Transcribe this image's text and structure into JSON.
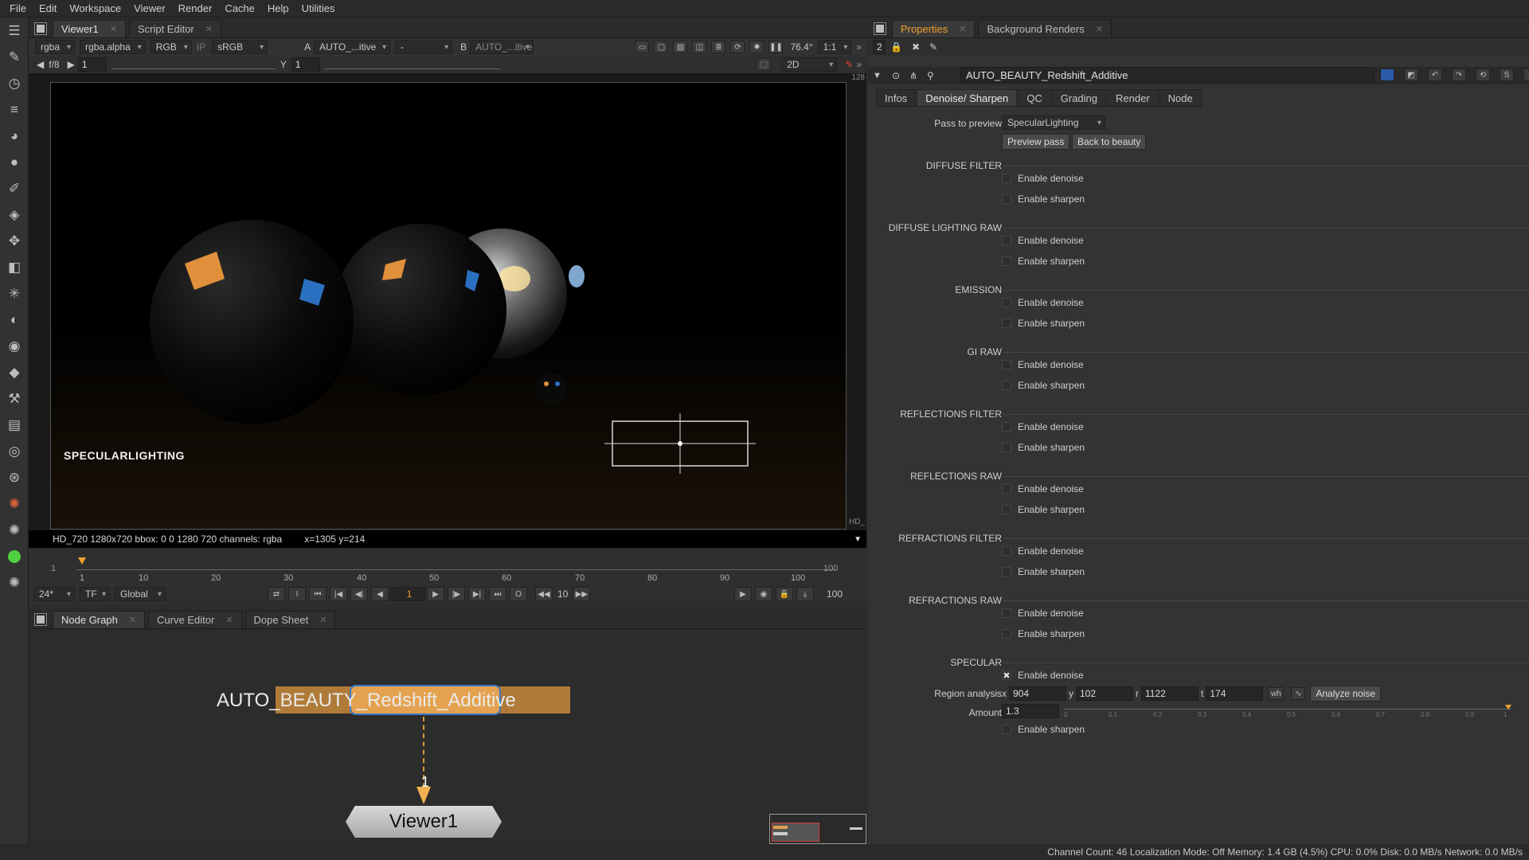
{
  "menu": [
    "File",
    "Edit",
    "Workspace",
    "Viewer",
    "Render",
    "Cache",
    "Help",
    "Utilities"
  ],
  "viewer_tabs": [
    {
      "label": "Viewer1"
    },
    {
      "label": "Script Editor"
    }
  ],
  "viewer_toolbar": {
    "channels": "rgba",
    "alpha": "rgba.alpha",
    "display": "RGB",
    "ip": "IP",
    "lut": "sRGB",
    "a_label": "A",
    "a_input": "AUTO_...itive",
    "a_op": "-",
    "b_label": "B",
    "b_input": "AUTO_...itive",
    "zoom": "76.4°",
    "ratio": "1:1",
    "mode": "2D"
  },
  "viewer_toolbar2": {
    "fstop": "f/8",
    "gain": "1",
    "gamma_label": "Y",
    "gamma": "1"
  },
  "viewer": {
    "frame_label": "SPECULARLIGHTING",
    "corner_top": "128",
    "corner_bottom": "HD_"
  },
  "info_bar": {
    "format": "HD_720 1280x720  bbox: 0 0 1280 720 channels: rgba",
    "coords": "x=1305 y=214"
  },
  "timeline": {
    "start": "1",
    "end": "100",
    "ticks": [
      "1",
      "10",
      "20",
      "30",
      "40",
      "50",
      "60",
      "70",
      "80",
      "90",
      "100"
    ]
  },
  "playback": {
    "fps": "24*",
    "tf": "TF",
    "range": "Global",
    "current": "1",
    "step": "10",
    "end": "100"
  },
  "lower_tabs": [
    {
      "label": "Node Graph"
    },
    {
      "label": "Curve Editor"
    },
    {
      "label": "Dope Sheet"
    }
  ],
  "node_graph": {
    "node": "AUTO_BEAUTY_Redshift_Additive",
    "viewer_node": "Viewer1",
    "pipe_num": "1"
  },
  "props_tabs": [
    {
      "label": "Properties"
    },
    {
      "label": "Background Renders"
    }
  ],
  "props": {
    "count": "2",
    "node_name": "AUTO_BEAUTY_Redshift_Additive",
    "tabs": [
      "Infos",
      "Denoise/ Sharpen",
      "QC",
      "Grading",
      "Render",
      "Node"
    ],
    "pass_label": "Pass to preview",
    "pass_value": "SpecularLighting",
    "preview_btn": "Preview pass",
    "back_btn": "Back to beauty",
    "sections": [
      {
        "title": "DIFFUSE FILTER",
        "denoise": "Enable denoise",
        "sharpen": "Enable sharpen"
      },
      {
        "title": "DIFFUSE LIGHTING RAW",
        "denoise": "Enable denoise",
        "sharpen": "Enable sharpen"
      },
      {
        "title": "EMISSION",
        "denoise": "Enable denoise",
        "sharpen": "Enable sharpen"
      },
      {
        "title": "GI RAW",
        "denoise": "Enable denoise",
        "sharpen": "Enable sharpen"
      },
      {
        "title": "REFLECTIONS FILTER",
        "denoise": "Enable denoise",
        "sharpen": "Enable sharpen"
      },
      {
        "title": "REFLECTIONS RAW",
        "denoise": "Enable denoise",
        "sharpen": "Enable sharpen"
      },
      {
        "title": "REFRACTIONS FILTER",
        "denoise": "Enable denoise",
        "sharpen": "Enable sharpen"
      },
      {
        "title": "REFRACTIONS RAW",
        "denoise": "Enable denoise",
        "sharpen": "Enable sharpen"
      }
    ],
    "specular": {
      "title": "SPECULAR",
      "denoise": "Enable denoise",
      "denoise_checked": "✖",
      "region_label": "Region analysis",
      "x_label": "x",
      "x": "904",
      "y_label": "y",
      "y": "102",
      "r_label": "r",
      "r": "1122",
      "t_label": "t",
      "t": "174",
      "wh": "wh",
      "analyze_btn": "Analyze noise",
      "amount_label": "Amount",
      "amount": "1.3",
      "amount_ticks": [
        "0",
        "0.1",
        "0.2",
        "0.3",
        "0.4",
        "0.5",
        "0.6",
        "0.7",
        "0.8",
        "0.9",
        "1"
      ],
      "sharpen": "Enable sharpen"
    }
  },
  "status": "Channel Count: 46  Localization Mode: Off  Memory: 1.4 GB (4.5%)  CPU: 0.0%  Disk: 0.0 MB/s  Network: 0.0 MB/s"
}
